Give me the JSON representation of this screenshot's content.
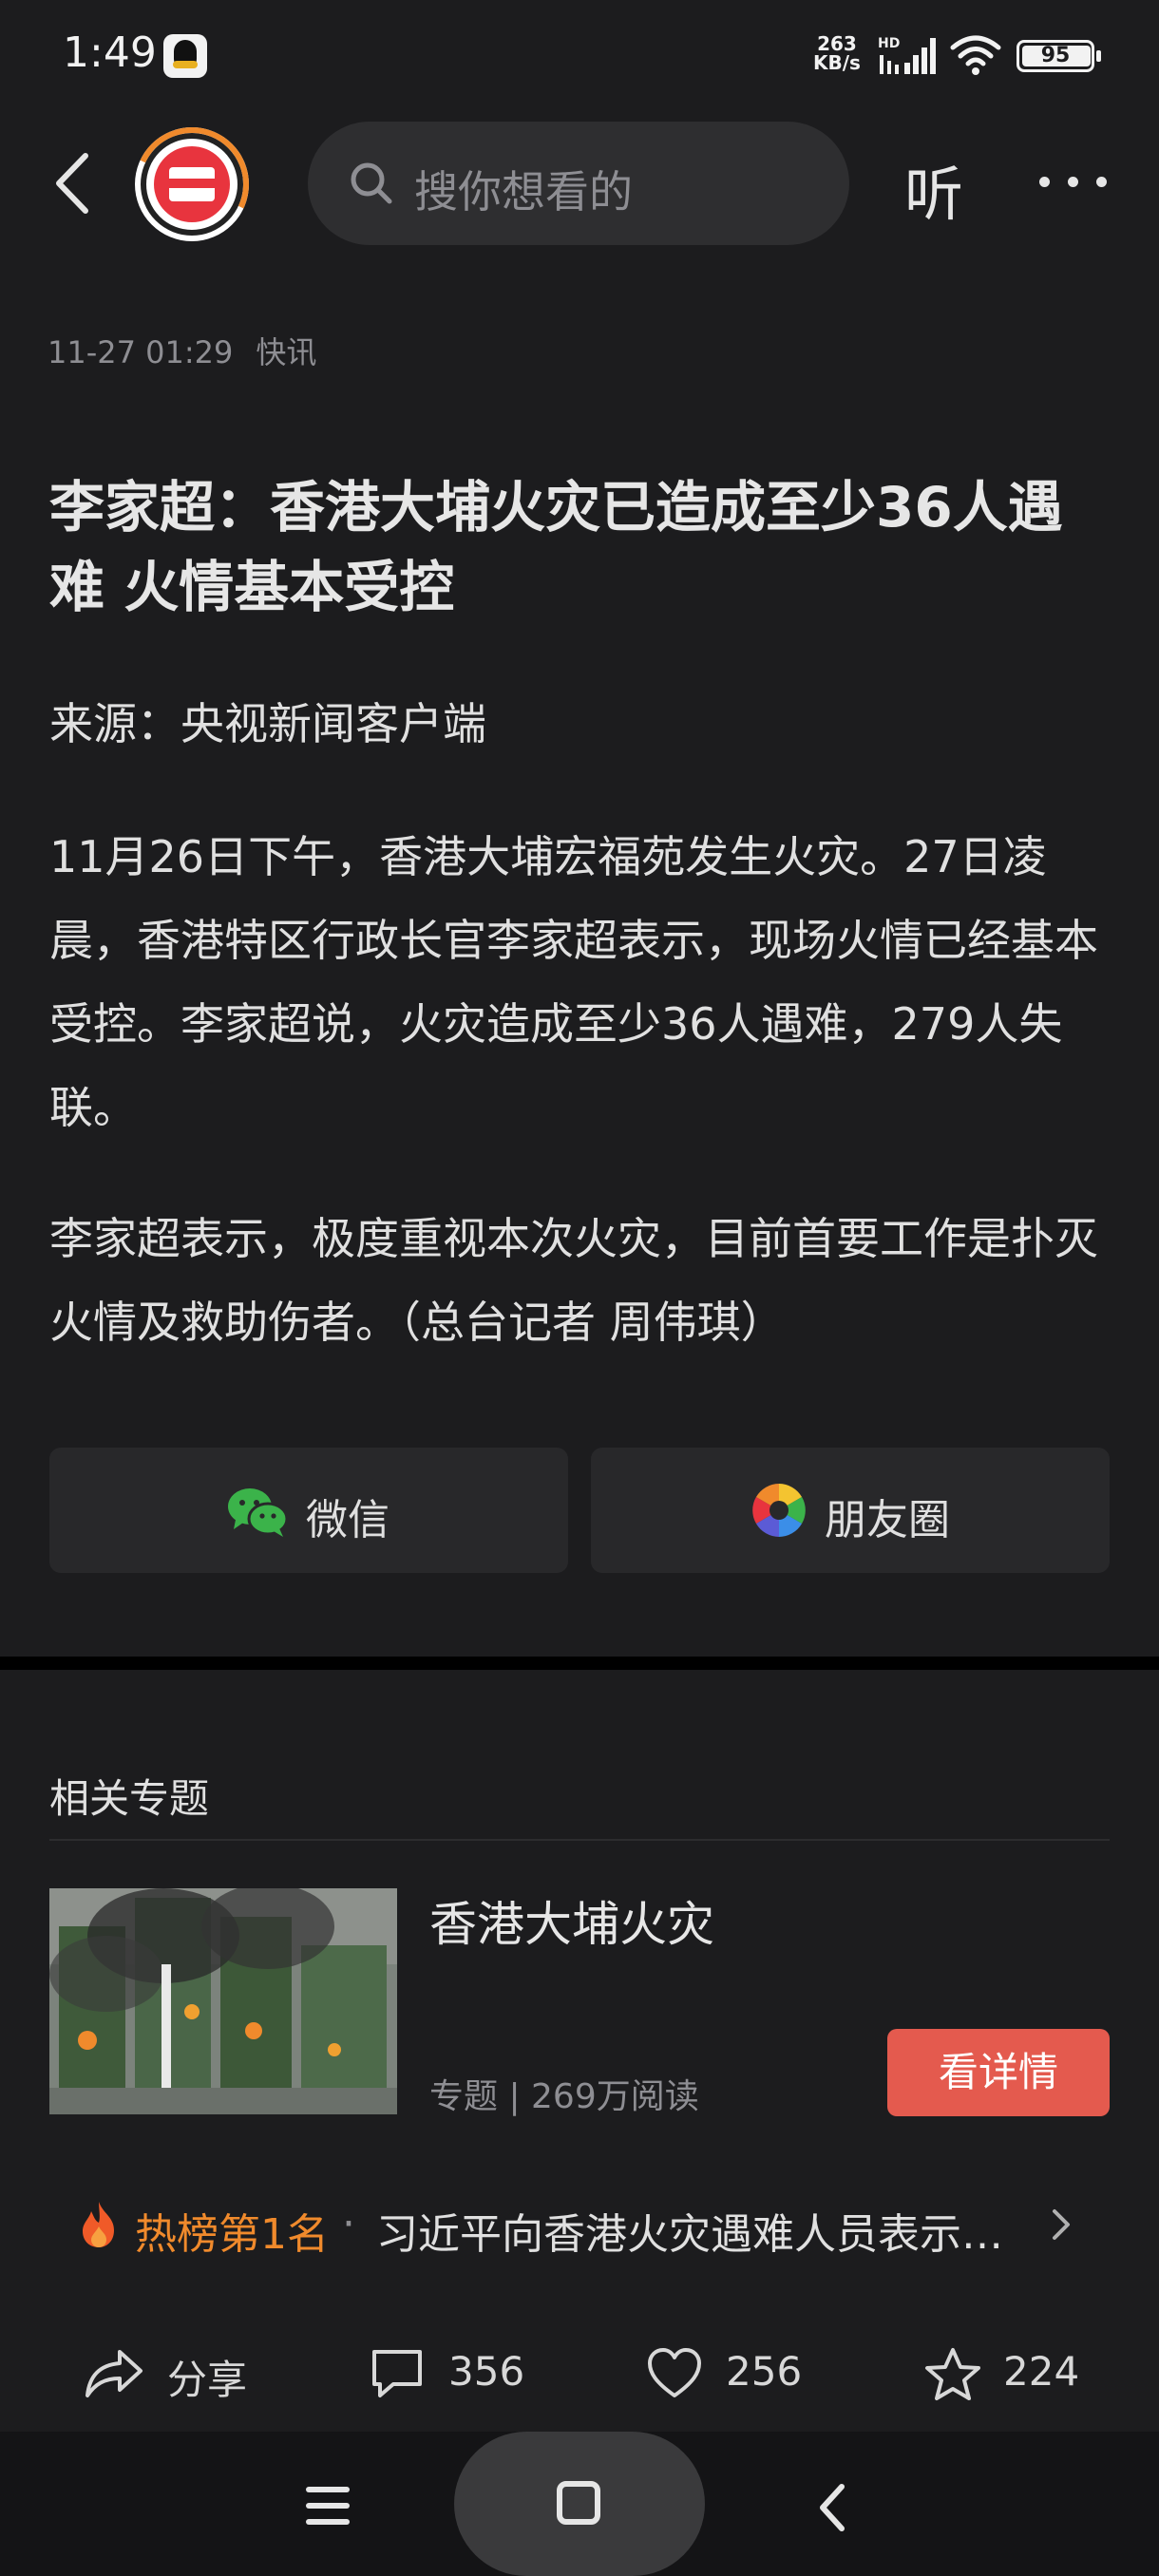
{
  "status_bar": {
    "time": "1:49",
    "net_speed_value": "263",
    "net_speed_unit": "KB/s",
    "hd_label": "HD",
    "battery": "95"
  },
  "nav": {
    "search_placeholder": "搜你想看的",
    "listen_label": "听"
  },
  "article": {
    "date": "11-27 01:29",
    "channel": "快讯",
    "title": "李家超：香港大埔火灾已造成至少36人遇难 火情基本受控",
    "source": "来源：央视新闻客户端",
    "paragraphs": [
      "11月26日下午，香港大埔宏福苑发生火灾。27日凌晨，香港特区行政长官李家超表示，现场火情已经基本受控。李家超说，火灾造成至少36人遇难，279人失联。",
      "李家超表示，极度重视本次火灾，目前首要工作是扑灭火情及救助伤者。（总台记者 周伟琪）"
    ]
  },
  "share": {
    "wechat_label": "微信",
    "moments_label": "朋友圈"
  },
  "topic": {
    "heading": "相关专题",
    "title": "香港大埔火灾",
    "stats": "专题 | 269万阅读",
    "detail_button": "看详情"
  },
  "hot": {
    "rank": "热榜第1名",
    "separator": "·",
    "text": "习近平向香港火灾遇难人员表示…"
  },
  "actions": {
    "share_label": "分享",
    "comment_count": "356",
    "like_count": "256",
    "favorite_count": "224"
  },
  "colors": {
    "background": "#1c1c1e",
    "accent_button": "#e45a4e",
    "hot_rank": "#f08a2c"
  }
}
